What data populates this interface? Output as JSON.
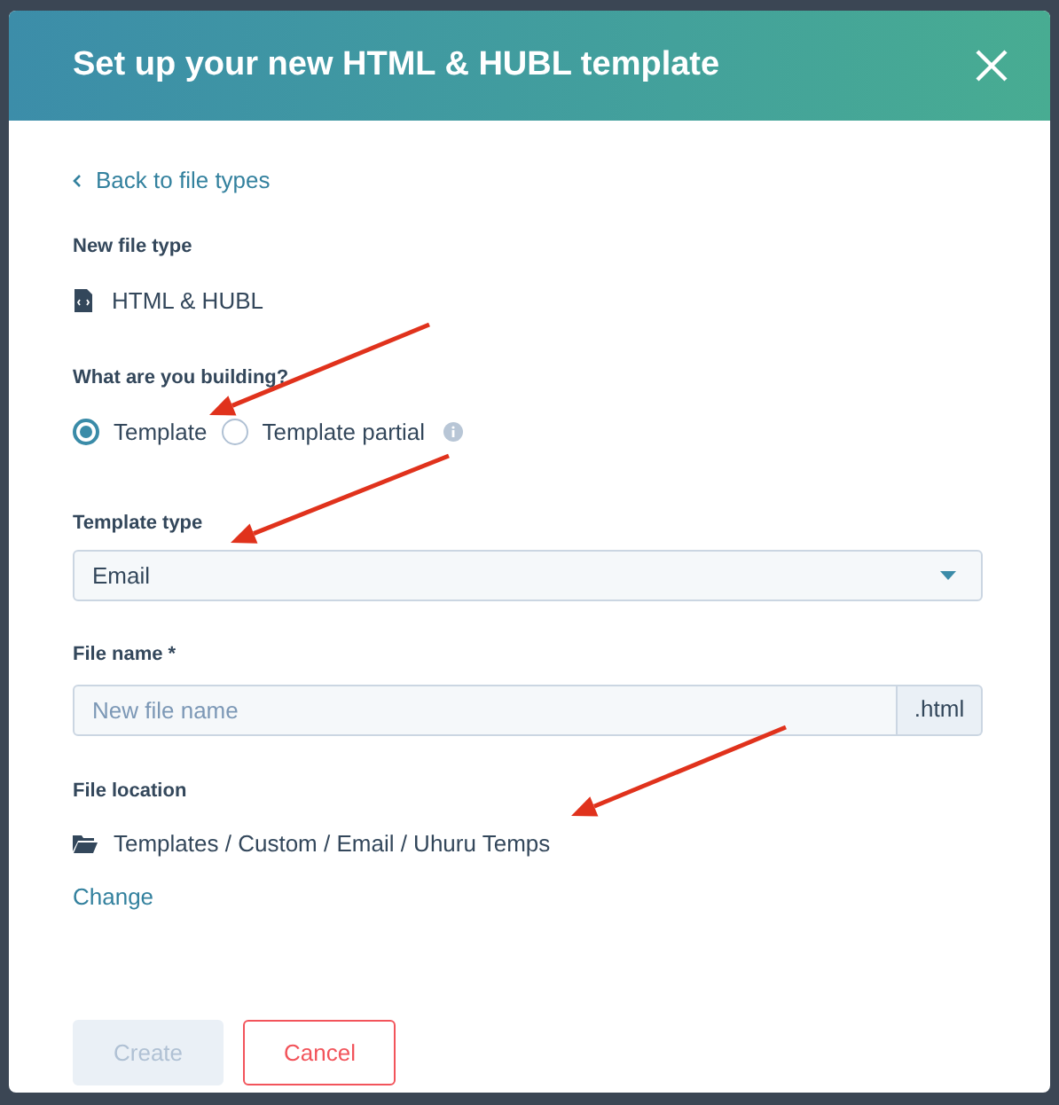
{
  "dialog": {
    "title": "Set up your new HTML & HUBL template"
  },
  "back_link": "Back to file types",
  "file_type": {
    "label": "New file type",
    "value": "HTML & HUBL"
  },
  "building": {
    "label": "What are you building?",
    "options": [
      {
        "label": "Template",
        "selected": true
      },
      {
        "label": "Template partial",
        "selected": false
      }
    ]
  },
  "template_type": {
    "label": "Template type",
    "value": "Email"
  },
  "file_name": {
    "label": "File name *",
    "placeholder": "New file name",
    "suffix": ".html"
  },
  "file_location": {
    "label": "File location",
    "path": "Templates / Custom / Email / Uhuru Temps",
    "change_link": "Change"
  },
  "buttons": [
    {
      "label": "Create",
      "kind": "primary",
      "disabled": true
    },
    {
      "label": "Cancel",
      "kind": "secondary",
      "disabled": false
    }
  ]
}
